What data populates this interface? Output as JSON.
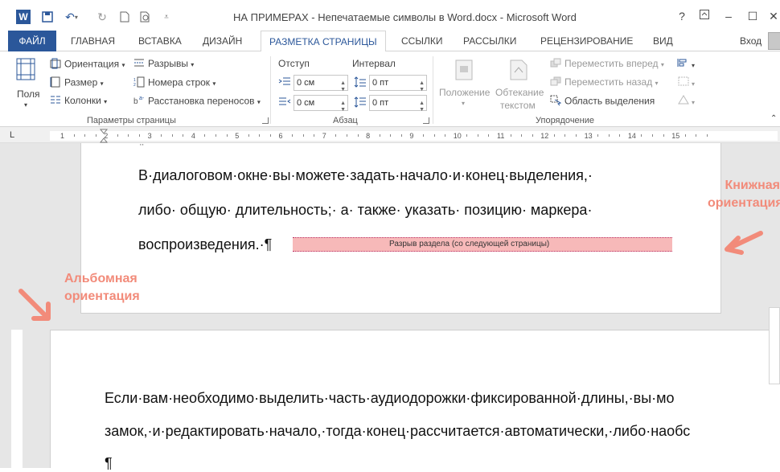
{
  "titlebar": {
    "title": "НА ПРИМЕРАХ - Непечатаемые символы в Word.docx - Microsoft Word",
    "help": "?",
    "minimize": "–",
    "maximize": "☐",
    "close": "✕"
  },
  "tabs": {
    "file": "ФАЙЛ",
    "items": [
      "ГЛАВНАЯ",
      "ВСТАВКА",
      "ДИЗАЙН",
      "РАЗМЕТКА СТРАНИЦЫ",
      "ССЫЛКИ",
      "РАССЫЛКИ",
      "РЕЦЕНЗИРОВАНИЕ",
      "ВИД"
    ],
    "login": "Вход"
  },
  "ribbon": {
    "page_setup": {
      "margins": "Поля",
      "orientation": "Ориентация",
      "size": "Размер",
      "columns": "Колонки",
      "breaks": "Разрывы",
      "line_numbers": "Номера строк",
      "hyphenation": "Расстановка переносов",
      "label": "Параметры страницы"
    },
    "paragraph": {
      "indent": "Отступ",
      "spacing": "Интервал",
      "indent_left": "0 см",
      "indent_right": "0 см",
      "spacing_before": "0 пт",
      "spacing_after": "0 пт",
      "label": "Абзац"
    },
    "arrange": {
      "position": "Положение",
      "wrap_line1": "Обтекание",
      "wrap_line2": "текстом",
      "bring_forward": "Переместить вперед",
      "send_backward": "Переместить назад",
      "selection_pane": "Область выделения",
      "label": "Упорядочение"
    }
  },
  "ruler": {
    "corner": "L",
    "numbers": [
      "1",
      "2",
      "3",
      "4",
      "5",
      "6",
      "7",
      "8",
      "9",
      "10",
      "11",
      "12",
      "13",
      "14",
      "15"
    ]
  },
  "document": {
    "page1_top_mark": "¨",
    "page1_line1": "В·диалоговом·окне·вы·можете·задать·начало·и·конец·выделения,·",
    "page1_line2": "либо· общую· длительность;· а· также· указать· позицию· маркера·",
    "page1_line3": "воспроизведения.·¶",
    "section_break": "Разрыв раздела (со следующей страницы)",
    "page2_line1": "Если·вам·необходимо·выделить·часть·аудиодорожки·фиксированной·длины,·вы·мо",
    "page2_line2": "замок,·и·редактировать·начало,·тогда·конец·рассчитается·автоматически,·либо·наобс",
    "page2_line3": "¶"
  },
  "annotations": {
    "portrait_line1": "Книжная",
    "portrait_line2": "ориентация",
    "landscape_line1": "Альбомная",
    "landscape_line2": "ориентация"
  }
}
